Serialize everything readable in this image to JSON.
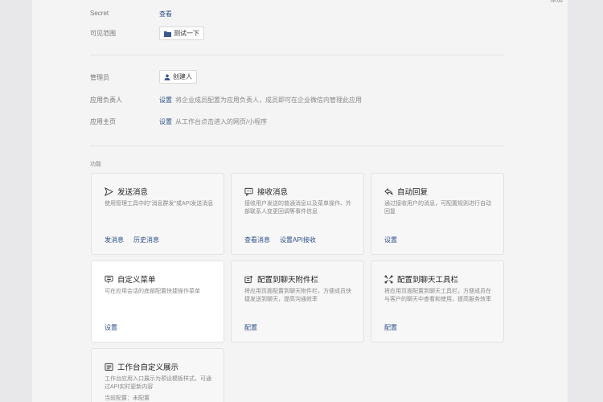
{
  "top_right_text": "添加",
  "rows": {
    "secret": {
      "label": "Secret",
      "action": "查看"
    },
    "visibility": {
      "label": "可见范围",
      "chip": "测试一下"
    },
    "admin": {
      "label": "管理员",
      "chip": "创建人"
    },
    "owner": {
      "label": "应用负责人",
      "action": "设置",
      "desc": "将企业成员配置为应用负责人，成员即可在企业微信内管理此应用"
    },
    "homepage": {
      "label": "应用主页",
      "action": "设置",
      "desc": "从工作台点击进入的网页/小程序"
    }
  },
  "section_label": "功能",
  "cards": [
    {
      "title": "发送消息",
      "icon": "send-icon",
      "desc": "使用管理工具中的\"消息群发\"或API发送消息",
      "actions": [
        "发消息",
        "历史消息"
      ]
    },
    {
      "title": "接收消息",
      "icon": "chat-icon",
      "desc": "接收用户发送的普通消息以及菜单操作、外部联系人变更回调等事件信息",
      "actions": [
        "查看消息",
        "设置API接收"
      ]
    },
    {
      "title": "自动回复",
      "icon": "reply-icon",
      "desc": "通过接收用户的消息，可配置规则进行自动回复",
      "actions": [
        "设置"
      ]
    },
    {
      "title": "自定义菜单",
      "icon": "menu-icon",
      "desc": "可在应用会话的底部配置快捷操作菜单",
      "actions": [
        "设置"
      ]
    },
    {
      "title": "配置到聊天附件栏",
      "icon": "attachment-icon",
      "desc": "将应用页面配置到聊天附件栏，方便成员快捷发送到聊天，提高沟通效率",
      "actions": [
        "配置"
      ]
    },
    {
      "title": "配置到聊天工具栏",
      "icon": "toolbar-icon",
      "desc": "将应用页面配置到聊天工具栏，方便成员在与客户的聊天中查看和使用，提高服务效率",
      "actions": [
        "配置"
      ]
    },
    {
      "title": "工作台自定义展示",
      "icon": "workbench-icon",
      "desc": "工作台应用入口展示为预设模板样式，可通过API实时更新内容",
      "actions": [],
      "footer": "当前配置：未配置"
    }
  ]
}
